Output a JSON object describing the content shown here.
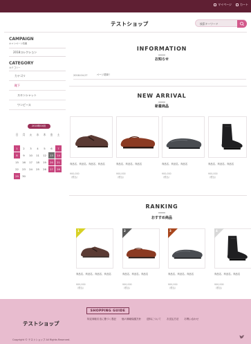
{
  "topbar": {
    "links": [
      {
        "label": "マイページ",
        "icon": "user-icon"
      },
      {
        "label": "カート",
        "icon": "cart-icon"
      }
    ],
    "color": "#5f1f33"
  },
  "header": {
    "shop_name": "テストショップ",
    "search_placeholder": "検索キーワード"
  },
  "sidebar": {
    "campaign": {
      "title": "CAMPAIGN",
      "subtitle": "キャンペーン情報",
      "item": "2018コレクション"
    },
    "category": {
      "title": "CATEGORY",
      "subtitle": "カテゴリー",
      "items": [
        "カテゴリ",
        "靴下",
        "スキンシャット",
        "ワンピース"
      ]
    }
  },
  "calendar": {
    "title": "2018年04月",
    "weekdays": [
      "日",
      "月",
      "火",
      "水",
      "木",
      "金",
      "土"
    ],
    "days": [
      [
        "",
        "",
        "",
        "",
        "",
        "",
        ""
      ],
      [
        "1",
        "2",
        "3",
        "4",
        "5",
        "6",
        "7"
      ],
      [
        "8",
        "9",
        "10",
        "11",
        "12",
        "13",
        "14"
      ],
      [
        "15",
        "16",
        "17",
        "18",
        "19",
        "20",
        "21"
      ],
      [
        "22",
        "23",
        "24",
        "25",
        "26",
        "27",
        "28"
      ],
      [
        "29",
        "30",
        "",
        "",
        "",
        "",
        ""
      ]
    ]
  },
  "information": {
    "title": "INFORMATION",
    "subtitle": "お知らせ",
    "news": [
      {
        "date": "2018.04.27",
        "text": "ページ更新！"
      }
    ]
  },
  "new_arrival": {
    "title": "NEW ARRIVAL",
    "subtitle": "新着商品",
    "products": [
      {
        "name": "商品名、商品名、商品名、商品名",
        "price": "¥00,000（税込）",
        "icon": "brown-strap-shoe"
      },
      {
        "name": "商品名、商品名、商品名",
        "price": "¥00,000（税込）",
        "icon": "brown-loafer"
      },
      {
        "name": "商品名、商品名、商品名",
        "price": "¥00,000（税込）",
        "icon": "grey-slipon"
      },
      {
        "name": "商品名、商品名、商品名",
        "price": "¥00,000（税込）",
        "icon": "black-boot"
      }
    ]
  },
  "ranking": {
    "title": "RANKING",
    "subtitle": "おすすめ商品",
    "badges": [
      "1",
      "2",
      "3",
      "4"
    ],
    "badge_colors": [
      "#d7d125",
      "#5a5a5a",
      "#a8461d",
      "#d8d8d8"
    ],
    "products": [
      {
        "name": "商品名、商品名、商品名、商品名",
        "price": "¥00,000（税込）"
      },
      {
        "name": "商品名、商品名、商品名",
        "price": "¥00,000（税込）"
      },
      {
        "name": "商品名、商品名、商品名",
        "price": "¥00,000（税込）"
      },
      {
        "name": "商品名、商品名、商品名",
        "price": "¥00,000（税込）"
      }
    ]
  },
  "footer": {
    "guide": "SHOPPING GUIDE",
    "links": [
      "特定商取引法に基づく表記",
      "個人情報保護方針",
      "送料について",
      "お支払方法",
      "お問い合わせ"
    ],
    "shop_name": "テストショップ",
    "copyright": "Copyright © テストショップ All Rights Reserved.",
    "color": "#e8bccf"
  }
}
